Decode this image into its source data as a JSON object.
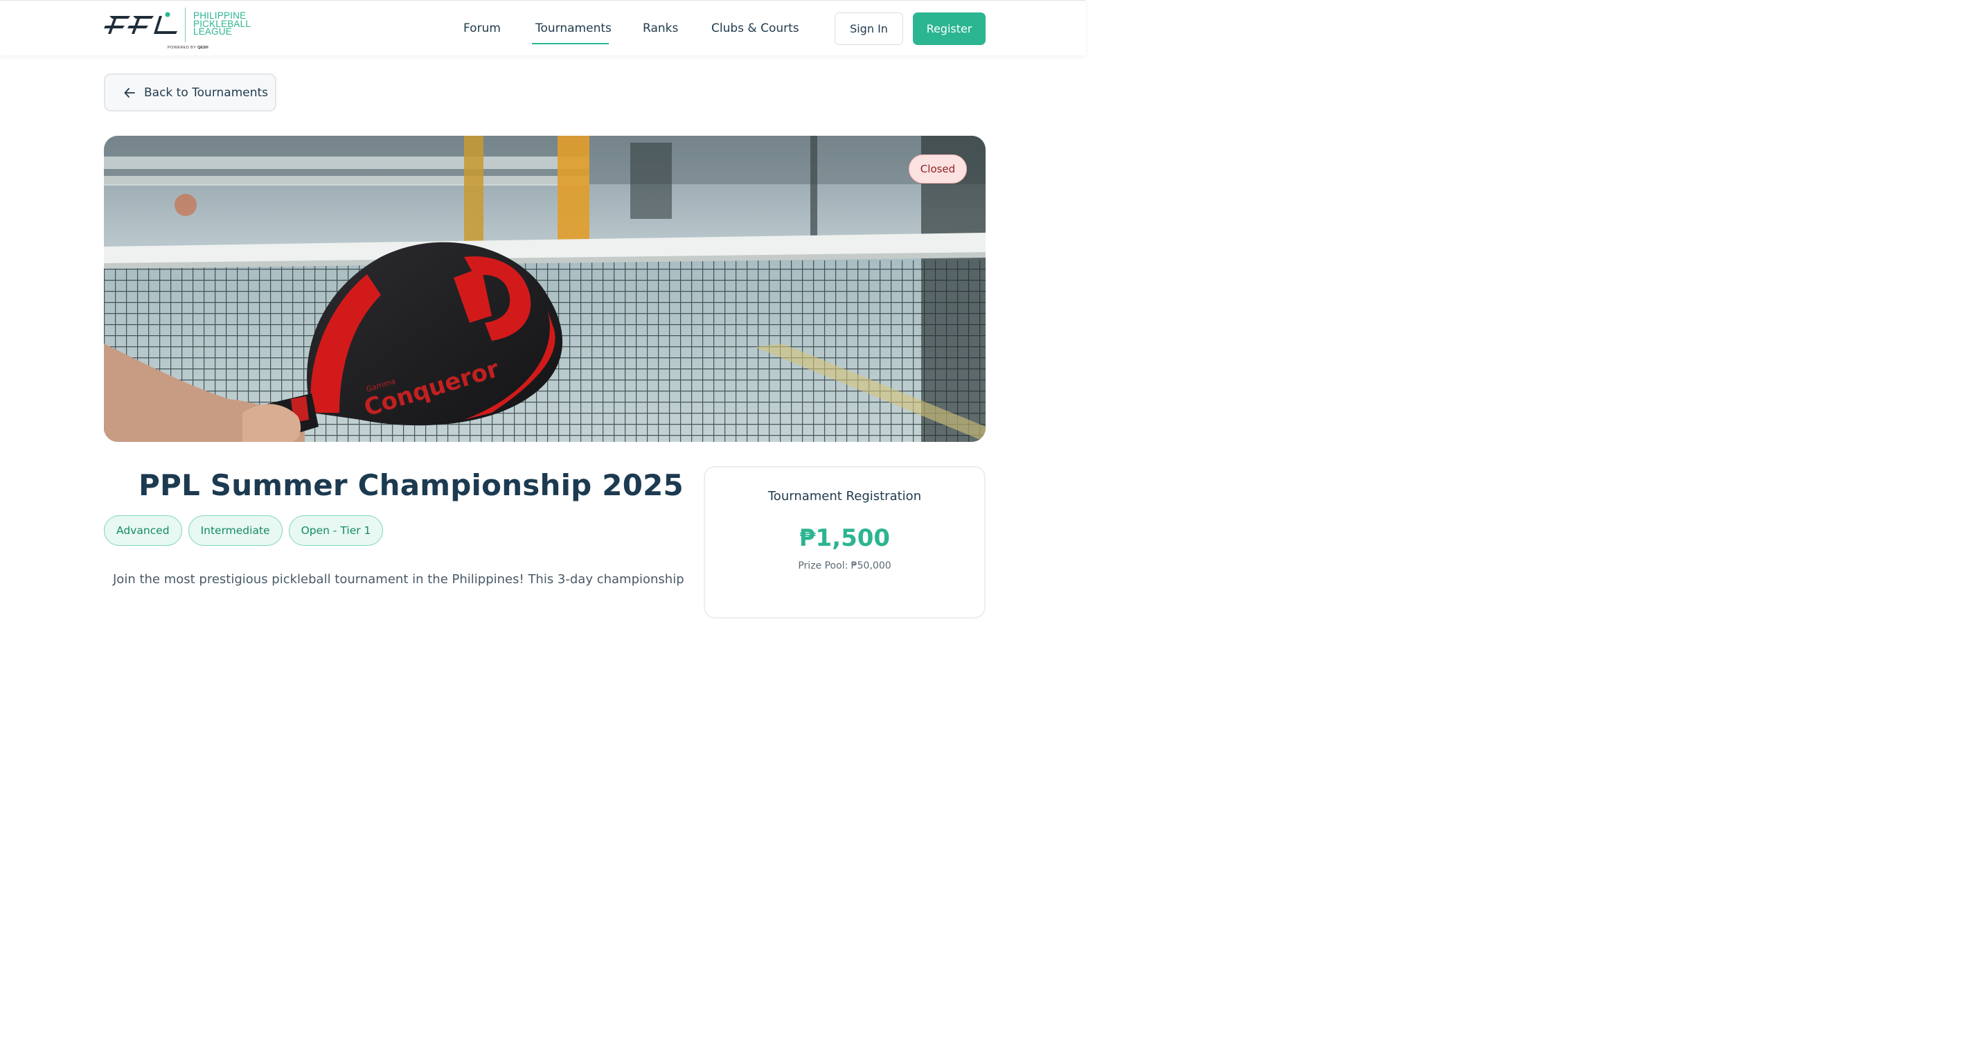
{
  "header": {
    "logo": {
      "mark": "PPL",
      "name_lines": [
        "PHILIPPINE",
        "PICKLEBALL",
        "LEAGUE"
      ],
      "powered_prefix": "POWERED BY",
      "powered_brand": "QESH"
    },
    "nav": [
      {
        "label": "Forum",
        "active": false
      },
      {
        "label": "Tournaments",
        "active": true
      },
      {
        "label": "Ranks",
        "active": false
      },
      {
        "label": "Clubs & Courts",
        "active": false
      }
    ],
    "sign_in_label": "Sign In",
    "register_label": "Register"
  },
  "back_button": {
    "label": "Back to Tournaments",
    "icon": "arrow-left-icon"
  },
  "hero": {
    "status": "Closed",
    "paddle_brand": "Gamma",
    "paddle_model": "Conqueror"
  },
  "tournament": {
    "title": "PPL Summer Championship 2025",
    "tags": [
      "Advanced",
      "Intermediate",
      "Open - Tier 1"
    ],
    "description": "Join the most prestigious pickleball tournament in the Philippines! This 3-day championship"
  },
  "registration": {
    "title": "Tournament Registration",
    "fee": "₱1,500",
    "prize_pool": "Prize Pool: ₱50,000"
  },
  "colors": {
    "accent": "#2bb591",
    "text_dark": "#1f3a4d",
    "closed_bg": "#fde2e2",
    "closed_text": "#8c1f1f"
  }
}
